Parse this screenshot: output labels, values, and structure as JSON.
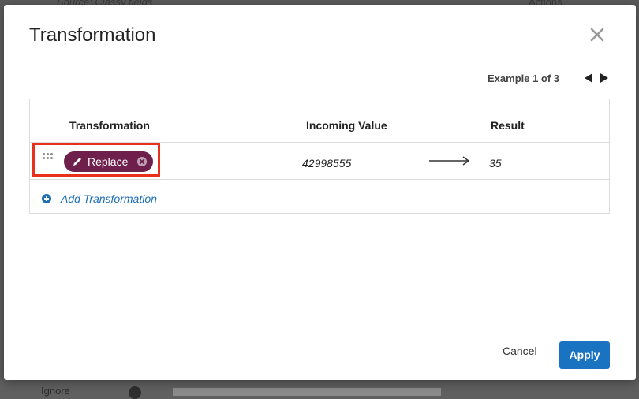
{
  "background": {
    "source_text": "Source: Classy fields",
    "actions_label": "Actions",
    "ignore_label": "Ignore"
  },
  "modal": {
    "title": "Transformation",
    "example_label": "Example 1 of 3",
    "columns": {
      "transformation": "Transformation",
      "incoming": "Incoming Value",
      "result": "Result"
    },
    "row": {
      "chip_label": "Replace",
      "incoming_value": "42998555",
      "result_value": "35"
    },
    "add_label": "Add Transformation",
    "cancel_label": "Cancel",
    "apply_label": "Apply"
  },
  "colors": {
    "chip": "#6e1f4c",
    "accent": "#1a73c0",
    "highlight": "#e8301d"
  }
}
